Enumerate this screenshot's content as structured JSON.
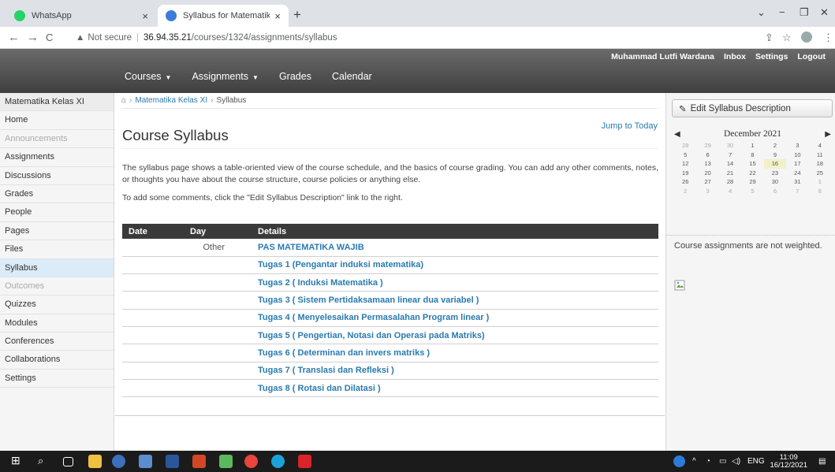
{
  "browser": {
    "tabs": [
      {
        "title": "WhatsApp",
        "close": "×"
      },
      {
        "title": "Syllabus for Matematika Wajib XI",
        "close": "×"
      }
    ],
    "new_tab": "+",
    "window_controls": {
      "min": "−",
      "restore": "❐",
      "close": "✕",
      "chevron": "⌄"
    },
    "address": {
      "security_label": "Not secure",
      "host": "36.94.35.21",
      "path": "/courses/1324/assignments/syllabus"
    },
    "nav": {
      "back": "←",
      "forward": "→",
      "reload": "C"
    },
    "addr_icons": {
      "share": "⇪",
      "star": "☆",
      "menu": "⋮"
    }
  },
  "header": {
    "user_nav": [
      "Muhammad Lutfi Wardana",
      "Inbox",
      "Settings",
      "Logout"
    ],
    "menu": [
      "Courses",
      "Assignments",
      "Grades",
      "Calendar"
    ]
  },
  "sidebar": {
    "course_name": "Matematika Kelas XI",
    "items": [
      {
        "label": "Home",
        "state": "normal"
      },
      {
        "label": "Announcements",
        "state": "disabled"
      },
      {
        "label": "Assignments",
        "state": "normal"
      },
      {
        "label": "Discussions",
        "state": "normal"
      },
      {
        "label": "Grades",
        "state": "normal"
      },
      {
        "label": "People",
        "state": "normal"
      },
      {
        "label": "Pages",
        "state": "normal"
      },
      {
        "label": "Files",
        "state": "normal"
      },
      {
        "label": "Syllabus",
        "state": "active"
      },
      {
        "label": "Outcomes",
        "state": "disabled"
      },
      {
        "label": "Quizzes",
        "state": "normal"
      },
      {
        "label": "Modules",
        "state": "normal"
      },
      {
        "label": "Conferences",
        "state": "normal"
      },
      {
        "label": "Collaborations",
        "state": "normal"
      },
      {
        "label": "Settings",
        "state": "normal"
      }
    ]
  },
  "breadcrumb": {
    "course": "Matematika Kelas XI",
    "current": "Syllabus"
  },
  "main": {
    "jump_link": "Jump to Today",
    "title": "Course Syllabus",
    "desc1": "The syllabus page shows a table-oriented view of the course schedule, and the basics of course grading. You can add any other comments, notes, or thoughts you have about the course structure, course policies or anything else.",
    "desc2": "To add some comments, click the \"Edit Syllabus Description\" link to the right.",
    "table": {
      "headers": [
        "Date",
        "Day",
        "Details"
      ],
      "rows": [
        {
          "date": "",
          "day": "Other",
          "detail": "PAS MATEMATIKA WAJIB"
        },
        {
          "date": "",
          "day": "",
          "detail": "Tugas 1 (Pengantar induksi matematika)"
        },
        {
          "date": "",
          "day": "",
          "detail": "Tugas 2 ( Induksi Matematika )"
        },
        {
          "date": "",
          "day": "",
          "detail": "Tugas 3 ( Sistem Pertidaksamaan linear dua variabel )"
        },
        {
          "date": "",
          "day": "",
          "detail": "Tugas 4 ( Menyelesaikan Permasalahan Program linear )"
        },
        {
          "date": "",
          "day": "",
          "detail": "Tugas 5 ( Pengertian, Notasi dan Operasi pada Matriks)"
        },
        {
          "date": "",
          "day": "",
          "detail": "Tugas 6 ( Determinan dan invers matriks )"
        },
        {
          "date": "",
          "day": "",
          "detail": "Tugas 7 ( Translasi dan Refleksi )"
        },
        {
          "date": "",
          "day": "",
          "detail": "Tugas 8 ( Rotasi dan Dilatasi )"
        }
      ]
    }
  },
  "right": {
    "edit_button": "Edit Syllabus Description",
    "calendar": {
      "month": "December 2021",
      "prev": "◀",
      "next": "▶",
      "weeks": [
        [
          "28",
          "29",
          "30",
          "1",
          "2",
          "3",
          "4"
        ],
        [
          "5",
          "6",
          "7",
          "8",
          "9",
          "10",
          "11"
        ],
        [
          "12",
          "13",
          "14",
          "15",
          "16",
          "17",
          "18"
        ],
        [
          "19",
          "20",
          "21",
          "22",
          "23",
          "24",
          "25"
        ],
        [
          "26",
          "27",
          "28",
          "29",
          "30",
          "31",
          "1"
        ],
        [
          "2",
          "3",
          "4",
          "5",
          "6",
          "7",
          "8"
        ]
      ],
      "today": "16"
    },
    "weight_note": "Course assignments are not weighted."
  },
  "taskbar": {
    "lang": "ENG",
    "time": "11:09",
    "date": "16/12/2021"
  }
}
